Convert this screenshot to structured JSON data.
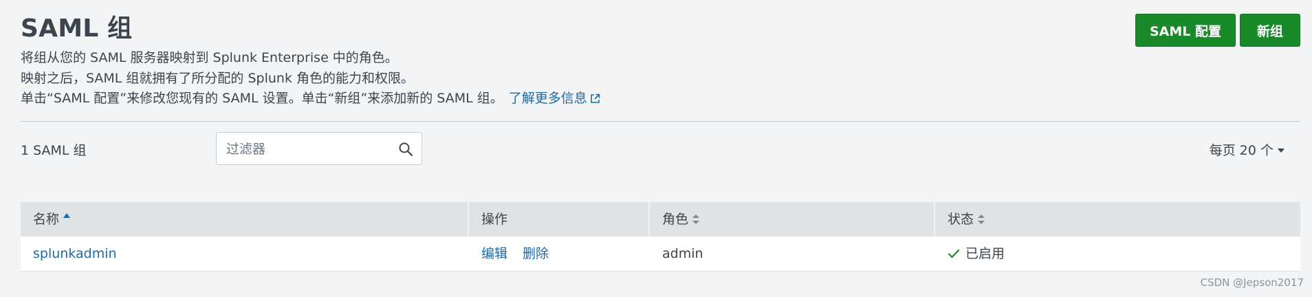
{
  "page": {
    "title": "SAML 组",
    "description": {
      "line1": "将组从您的 SAML 服务器映射到 Splunk Enterprise 中的角色。",
      "line2": "映射之后，SAML 组就拥有了所分配的 Splunk 角色的能力和权限。",
      "line3": "单击“SAML 配置”来修改您现有的 SAML 设置。单击“新组”来添加新的 SAML 组。",
      "learn_more": "了解更多信息"
    }
  },
  "toolbar": {
    "saml_config_label": "SAML 配置",
    "new_group_label": "新组"
  },
  "controls": {
    "count_label": "1 SAML 组",
    "filter_placeholder": "过滤器",
    "per_page_label": "每页 20 个"
  },
  "table": {
    "columns": {
      "name": "名称",
      "actions": "操作",
      "role": "角色",
      "status": "状态"
    },
    "rows": [
      {
        "name": "splunkadmin",
        "edit_label": "编辑",
        "delete_label": "删除",
        "role": "admin",
        "status": "已启用"
      }
    ]
  },
  "watermark": "CSDN @Jepson2017",
  "colors": {
    "background": "#f2f4f5",
    "primary_button": "#1a8929",
    "link": "#1a6baa",
    "header_row": "#dfe3e6",
    "status_ok": "#1a8929"
  },
  "icons": {
    "search": "search-icon",
    "external_link": "external-link-icon",
    "check": "check-icon",
    "sort_ascending": "sort-asc-icon",
    "sort_both": "sort-icon",
    "dropdown": "chevron-down-icon"
  }
}
